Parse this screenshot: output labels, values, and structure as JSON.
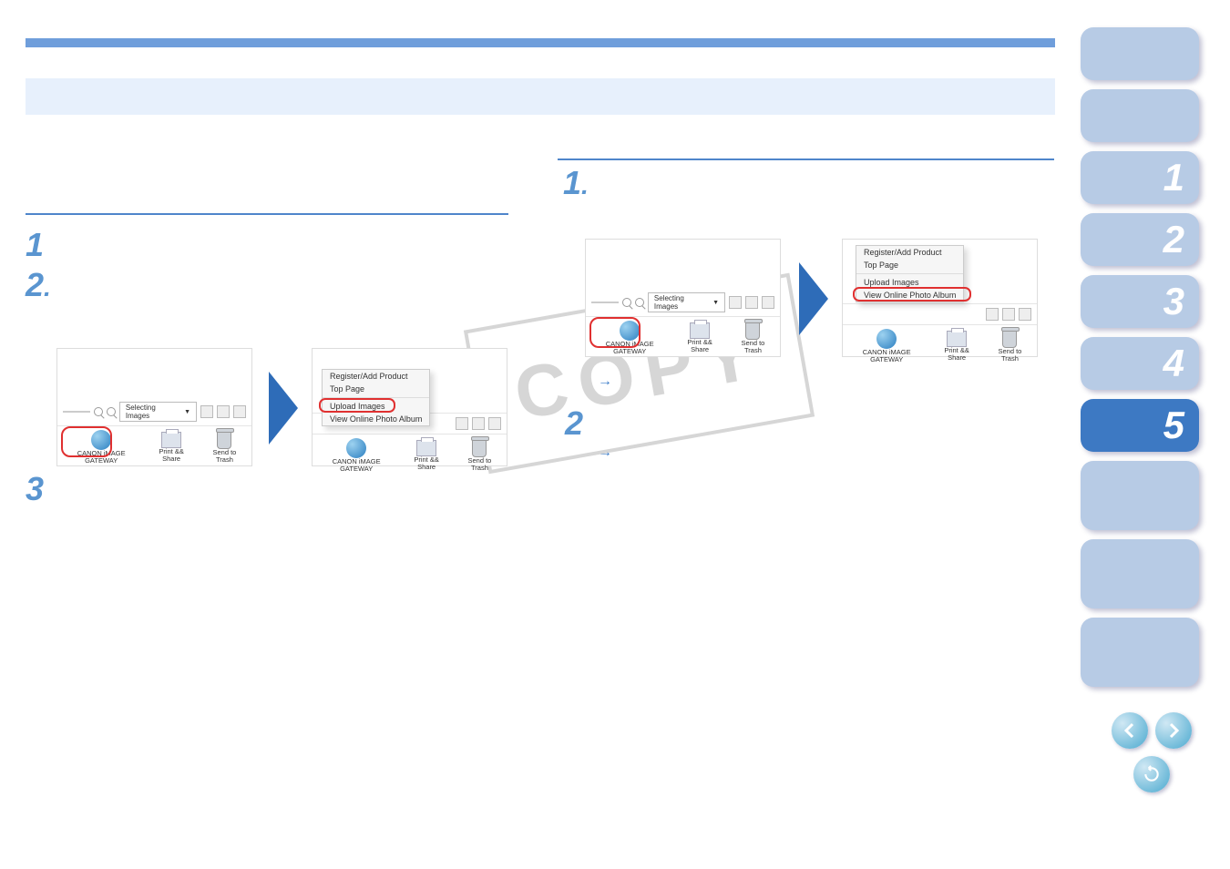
{
  "watermark": "COPY",
  "step2_arrow": "→",
  "toolbar": {
    "selecting": "Selecting Images",
    "canon": "CANON iMAGE GATEWAY",
    "print": "Print && Share",
    "trash": "Send to Trash"
  },
  "menu": {
    "register": "Register/Add Product",
    "top": "Top Page",
    "upload": "Upload Images",
    "view": "View Online Photo Album"
  },
  "side": {
    "n1": "1",
    "n2": "2",
    "n3": "3",
    "n4": "4",
    "n5": "5"
  },
  "nums": {
    "l1": "1",
    "l2": "2",
    "l3": "3",
    "r1": "1",
    "r2": "2",
    "dot": "."
  }
}
